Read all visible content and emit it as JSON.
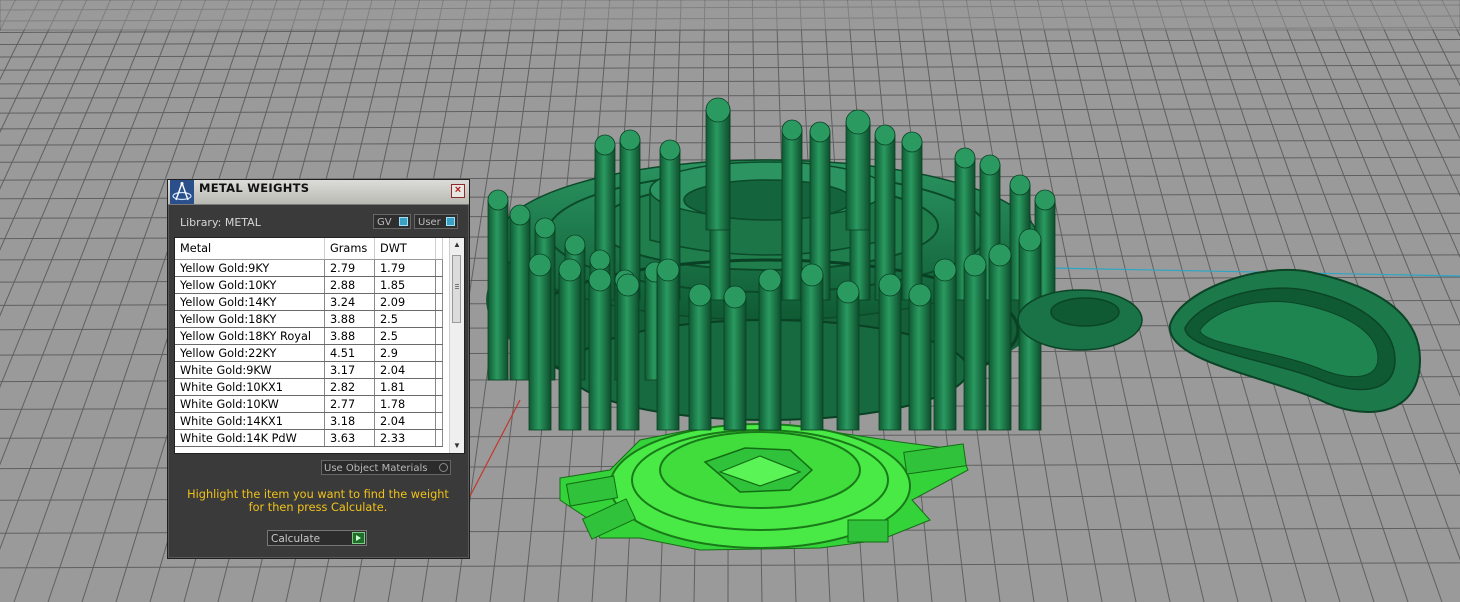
{
  "panel": {
    "title": "METAL WEIGHTS",
    "close": "×",
    "library": "Library: METAL",
    "toggles": {
      "gv": "GV",
      "user": "User"
    },
    "table": {
      "headers": [
        "Metal",
        "Grams",
        "DWT"
      ],
      "rows": [
        [
          "Yellow Gold:9KY",
          "2.79",
          "1.79"
        ],
        [
          "Yellow Gold:10KY",
          "2.88",
          "1.85"
        ],
        [
          "Yellow Gold:14KY",
          "3.24",
          "2.09"
        ],
        [
          "Yellow Gold:18KY",
          "3.88",
          "2.5"
        ],
        [
          "Yellow Gold:18KY Royal",
          "3.88",
          "2.5"
        ],
        [
          "Yellow Gold:22KY",
          "4.51",
          "2.9"
        ],
        [
          "White Gold:9KW",
          "3.17",
          "2.04"
        ],
        [
          "White Gold:10KX1",
          "2.82",
          "1.81"
        ],
        [
          "White Gold:10KW",
          "2.77",
          "1.78"
        ],
        [
          "White Gold:14KX1",
          "3.18",
          "2.04"
        ],
        [
          "White Gold:14K PdW",
          "3.63",
          "2.33"
        ]
      ]
    },
    "use_object_materials": "Use Object Materials",
    "hint": "Highlight the item you want to find the weight for then press Calculate.",
    "calculate_label": "Calculate"
  },
  "colors": {
    "viewport_bg": "#9a9a9a",
    "model_green": "#1c7a4a",
    "selected_green": "#3fe23c",
    "panel_bg": "#3a3a3a",
    "hint_yellow": "#f0c21a"
  }
}
